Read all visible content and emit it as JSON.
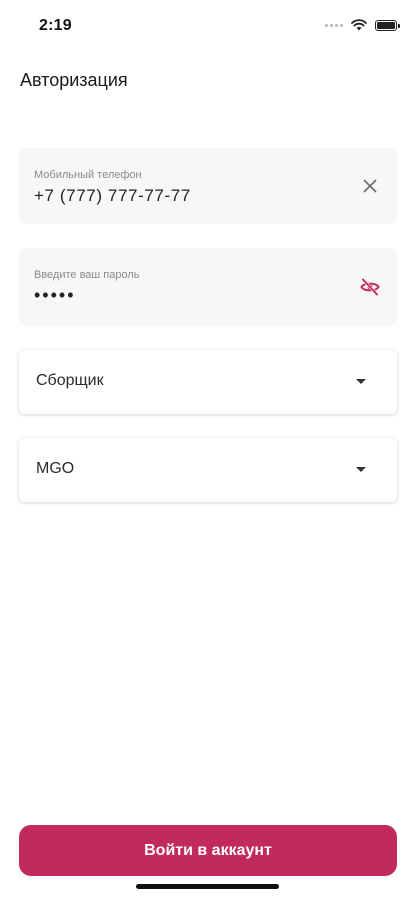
{
  "status_bar": {
    "time": "2:19"
  },
  "page": {
    "title": "Авторизация"
  },
  "phone_field": {
    "label": "Мобильный телефон",
    "value": "+7 (777) 777-77-77",
    "clear_icon": "close-icon"
  },
  "password_field": {
    "label": "Введите ваш пароль",
    "value": "•••••",
    "visibility_icon": "eye-off-icon"
  },
  "role_select": {
    "value": "Сборщик"
  },
  "store_select": {
    "value": "MGO"
  },
  "actions": {
    "login_label": "Войти в аккаунт"
  },
  "colors": {
    "accent": "#c22a5c",
    "field_background": "#f7f7f7"
  }
}
